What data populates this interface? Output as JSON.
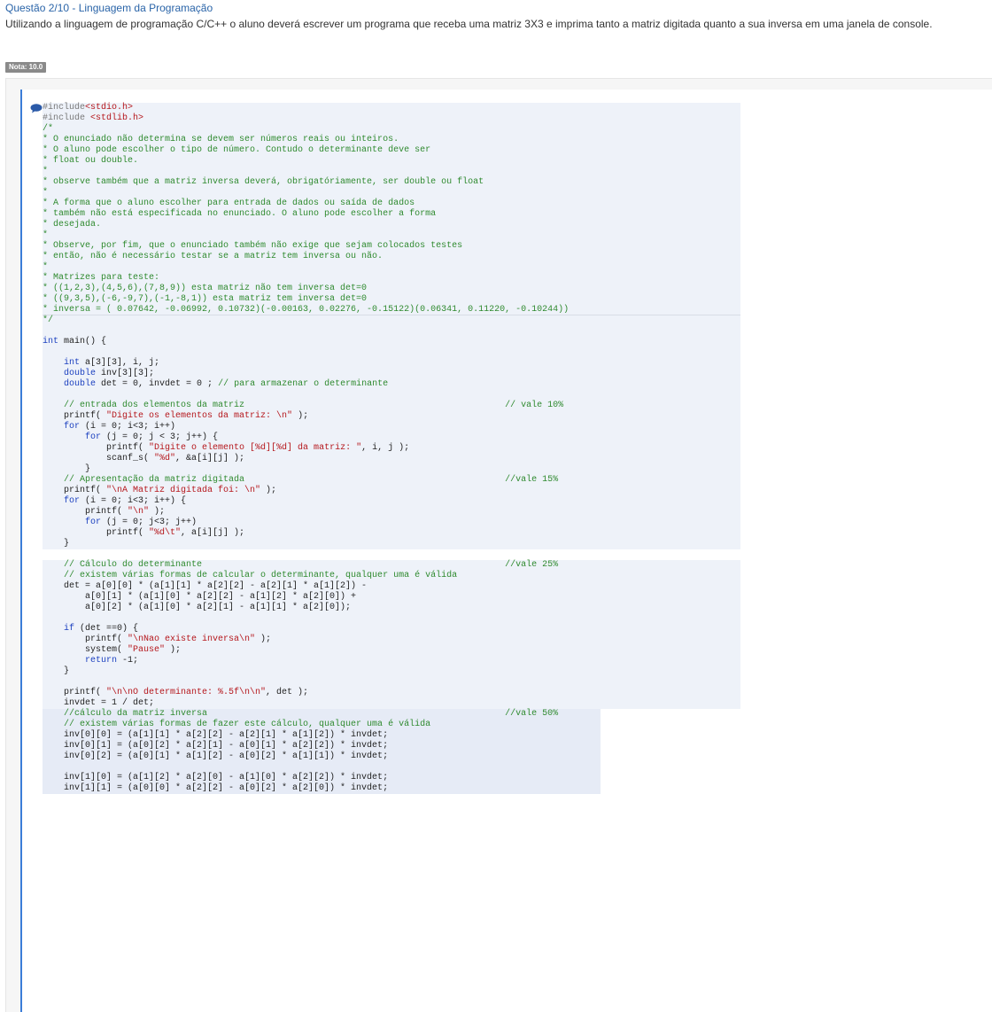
{
  "question": {
    "title": "Questão 2/10 - Linguagem da Programação",
    "description": "Utilizando a linguagem de programação C/C++ o aluno deverá escrever um programa que receba uma matriz 3X3 e imprima tanto a matriz digitada quanto a sua inversa em uma janela de console.",
    "grade_badge": "Nota: 10.0"
  },
  "colors": {
    "accent": "#2a64a8",
    "keyword": "#1a3fbf",
    "string": "#b5171c",
    "comment": "#2f8a2f",
    "highlight": "#eef2f9"
  },
  "icons": {
    "comment_marker": "speech-bubble-icon"
  },
  "code_lines": [
    {
      "hl": "a",
      "t": [
        [
          "p",
          "#include"
        ],
        [
          "s",
          "<stdio.h>"
        ]
      ]
    },
    {
      "hl": "a",
      "t": [
        [
          "p",
          "#include "
        ],
        [
          "s",
          "<stdlib.h>"
        ]
      ]
    },
    {
      "hl": "a",
      "t": [
        [
          "c",
          "/*"
        ]
      ]
    },
    {
      "hl": "a",
      "t": [
        [
          "c",
          "* O enunciado não determina se devem ser números reais ou inteiros."
        ]
      ]
    },
    {
      "hl": "a",
      "t": [
        [
          "c",
          "* O aluno pode escolher o tipo de número. Contudo o determinante deve ser"
        ]
      ]
    },
    {
      "hl": "a",
      "t": [
        [
          "c",
          "* float ou double."
        ]
      ]
    },
    {
      "hl": "a",
      "t": [
        [
          "c",
          "*"
        ]
      ]
    },
    {
      "hl": "a",
      "t": [
        [
          "c",
          "* observe também que a matriz inversa deverá, obrigatóriamente, ser double ou float"
        ]
      ]
    },
    {
      "hl": "a",
      "t": [
        [
          "c",
          "*"
        ]
      ]
    },
    {
      "hl": "a",
      "t": [
        [
          "c",
          "* A forma que o aluno escolher para entrada de dados ou saída de dados"
        ]
      ]
    },
    {
      "hl": "a",
      "t": [
        [
          "c",
          "* também não está especificada no enunciado. O aluno pode escolher a forma"
        ]
      ]
    },
    {
      "hl": "a",
      "t": [
        [
          "c",
          "* desejada."
        ]
      ]
    },
    {
      "hl": "a",
      "t": [
        [
          "c",
          "*"
        ]
      ]
    },
    {
      "hl": "a",
      "t": [
        [
          "c",
          "* Observe, por fim, que o enunciado também não exige que sejam colocados testes"
        ]
      ]
    },
    {
      "hl": "a",
      "t": [
        [
          "c",
          "* então, não é necessário testar se a matriz tem inversa ou não."
        ]
      ]
    },
    {
      "hl": "a",
      "t": [
        [
          "c",
          "*"
        ]
      ]
    },
    {
      "hl": "a",
      "t": [
        [
          "c",
          "* Matrizes para teste:"
        ]
      ]
    },
    {
      "hl": "a",
      "t": [
        [
          "c",
          "* ((1,2,3),(4,5,6),(7,8,9)) esta matriz não tem inversa det=0"
        ]
      ]
    },
    {
      "hl": "a",
      "t": [
        [
          "c",
          "* ((9,3,5),(-6,-9,7),(-1,-8,1)) esta matriz tem inversa det=0"
        ]
      ]
    },
    {
      "hl": "ag",
      "t": [
        [
          "c",
          "* inversa = ( 0.07642, -0.06992, 0.10732)(-0.00163, 0.02276, -0.15122)(0.06341, 0.11220, -0.10244))"
        ]
      ]
    },
    {
      "hl": "a",
      "t": [
        [
          "c",
          "*/"
        ]
      ]
    },
    {
      "hl": "a",
      "t": []
    },
    {
      "hl": "a",
      "t": [
        [
          "k",
          "int"
        ],
        [
          "n",
          " main() {"
        ]
      ]
    },
    {
      "hl": "a",
      "t": []
    },
    {
      "hl": "a",
      "t": [
        [
          "n",
          "    "
        ],
        [
          "k",
          "int"
        ],
        [
          "n",
          " a[3][3], i, j;"
        ]
      ]
    },
    {
      "hl": "a",
      "t": [
        [
          "n",
          "    "
        ],
        [
          "k",
          "double"
        ],
        [
          "n",
          " inv[3][3];"
        ]
      ]
    },
    {
      "hl": "a",
      "t": [
        [
          "n",
          "    "
        ],
        [
          "k",
          "double"
        ],
        [
          "n",
          " det = 0, invdet = 0 ; "
        ],
        [
          "c",
          "// para armazenar o determinante"
        ]
      ]
    },
    {
      "hl": "a",
      "t": []
    },
    {
      "hl": "a",
      "t": [
        [
          "c",
          "    // entrada dos elementos da matriz                                                 // vale 10%"
        ]
      ]
    },
    {
      "hl": "a",
      "t": [
        [
          "n",
          "    printf( "
        ],
        [
          "s",
          "\"Digite os elementos da matriz: \\n\""
        ],
        [
          "n",
          " );"
        ]
      ]
    },
    {
      "hl": "a",
      "t": [
        [
          "n",
          "    "
        ],
        [
          "k",
          "for"
        ],
        [
          "n",
          " (i = 0; i<3; i++)"
        ]
      ]
    },
    {
      "hl": "a",
      "t": [
        [
          "n",
          "        "
        ],
        [
          "k",
          "for"
        ],
        [
          "n",
          " (j = 0; j < 3; j++) {"
        ]
      ]
    },
    {
      "hl": "a",
      "t": [
        [
          "n",
          "            printf( "
        ],
        [
          "s",
          "\"Digite o elemento [%d][%d] da matriz: \""
        ],
        [
          "n",
          ", i, j );"
        ]
      ]
    },
    {
      "hl": "a",
      "t": [
        [
          "n",
          "            scanf_s( "
        ],
        [
          "s",
          "\"%d\""
        ],
        [
          "n",
          ", &a[i][j] );"
        ]
      ]
    },
    {
      "hl": "a",
      "t": [
        [
          "n",
          "        }"
        ]
      ]
    },
    {
      "hl": "a",
      "t": [
        [
          "c",
          "    // Apresentação da matriz digitada                                                 //vale 15%"
        ]
      ]
    },
    {
      "hl": "a",
      "t": [
        [
          "n",
          "    printf( "
        ],
        [
          "s",
          "\"\\nA Matriz digitada foi: \\n\""
        ],
        [
          "n",
          " );"
        ]
      ]
    },
    {
      "hl": "a",
      "t": [
        [
          "n",
          "    "
        ],
        [
          "k",
          "for"
        ],
        [
          "n",
          " (i = 0; i<3; i++) {"
        ]
      ]
    },
    {
      "hl": "a",
      "t": [
        [
          "n",
          "        printf( "
        ],
        [
          "s",
          "\"\\n\""
        ],
        [
          "n",
          " );"
        ]
      ]
    },
    {
      "hl": "a",
      "t": [
        [
          "n",
          "        "
        ],
        [
          "k",
          "for"
        ],
        [
          "n",
          " (j = 0; j<3; j++)"
        ]
      ]
    },
    {
      "hl": "a",
      "t": [
        [
          "n",
          "            printf( "
        ],
        [
          "s",
          "\"%d\\t\""
        ],
        [
          "n",
          ", a[i][j] );"
        ]
      ]
    },
    {
      "hl": "a",
      "t": [
        [
          "n",
          "    }"
        ]
      ]
    },
    {
      "hl": "",
      "t": []
    },
    {
      "hl": "a",
      "t": [
        [
          "c",
          "    // Cálculo do determinante                                                         //vale 25%"
        ]
      ]
    },
    {
      "hl": "a",
      "t": [
        [
          "c",
          "    // existem várias formas de calcular o determinante, qualquer uma é válida"
        ]
      ]
    },
    {
      "hl": "a",
      "t": [
        [
          "n",
          "    det = a[0][0] * (a[1][1] * a[2][2] - a[2][1] * a[1][2]) -"
        ]
      ]
    },
    {
      "hl": "a",
      "t": [
        [
          "n",
          "        a[0][1] * (a[1][0] * a[2][2] - a[1][2] * a[2][0]) +"
        ]
      ]
    },
    {
      "hl": "a",
      "t": [
        [
          "n",
          "        a[0][2] * (a[1][0] * a[2][1] - a[1][1] * a[2][0]);"
        ]
      ]
    },
    {
      "hl": "a",
      "t": []
    },
    {
      "hl": "a",
      "t": [
        [
          "n",
          "    "
        ],
        [
          "k",
          "if"
        ],
        [
          "n",
          " (det ==0) {"
        ]
      ]
    },
    {
      "hl": "a",
      "t": [
        [
          "n",
          "        printf( "
        ],
        [
          "s",
          "\"\\nNao existe inversa\\n\""
        ],
        [
          "n",
          " );"
        ]
      ]
    },
    {
      "hl": "a",
      "t": [
        [
          "n",
          "        system( "
        ],
        [
          "s",
          "\"Pause\""
        ],
        [
          "n",
          " );"
        ]
      ]
    },
    {
      "hl": "a",
      "t": [
        [
          "n",
          "        "
        ],
        [
          "k",
          "return"
        ],
        [
          "n",
          " -1;"
        ]
      ]
    },
    {
      "hl": "a",
      "t": [
        [
          "n",
          "    }"
        ]
      ]
    },
    {
      "hl": "a",
      "t": []
    },
    {
      "hl": "a",
      "t": [
        [
          "n",
          "    printf( "
        ],
        [
          "s",
          "\"\\n\\nO determinante: %.5f\\n\\n\""
        ],
        [
          "n",
          ", det );"
        ]
      ]
    },
    {
      "hl": "a",
      "t": [
        [
          "n",
          "    invdet = 1 / det;"
        ]
      ]
    },
    {
      "hl": "b",
      "t": [
        [
          "c",
          "    //cálculo da matriz inversa                                                        //vale 50%"
        ]
      ]
    },
    {
      "hl": "b",
      "t": [
        [
          "c",
          "    // existem várias formas de fazer este cálculo, qualquer uma é válida"
        ]
      ]
    },
    {
      "hl": "b",
      "t": [
        [
          "n",
          "    inv[0][0] = (a[1][1] * a[2][2] - a[2][1] * a[1][2]) * invdet;"
        ]
      ]
    },
    {
      "hl": "b",
      "t": [
        [
          "n",
          "    inv[0][1] = (a[0][2] * a[2][1] - a[0][1] * a[2][2]) * invdet;"
        ]
      ]
    },
    {
      "hl": "b",
      "t": [
        [
          "n",
          "    inv[0][2] = (a[0][1] * a[1][2] - a[0][2] * a[1][1]) * invdet;"
        ]
      ]
    },
    {
      "hl": "b",
      "t": []
    },
    {
      "hl": "b",
      "t": [
        [
          "n",
          "    inv[1][0] = (a[1][2] * a[2][0] - a[1][0] * a[2][2]) * invdet;"
        ]
      ]
    },
    {
      "hl": "b",
      "t": [
        [
          "n",
          "    inv[1][1] = (a[0][0] * a[2][2] - a[0][2] * a[2][0]) * invdet;"
        ]
      ]
    }
  ]
}
